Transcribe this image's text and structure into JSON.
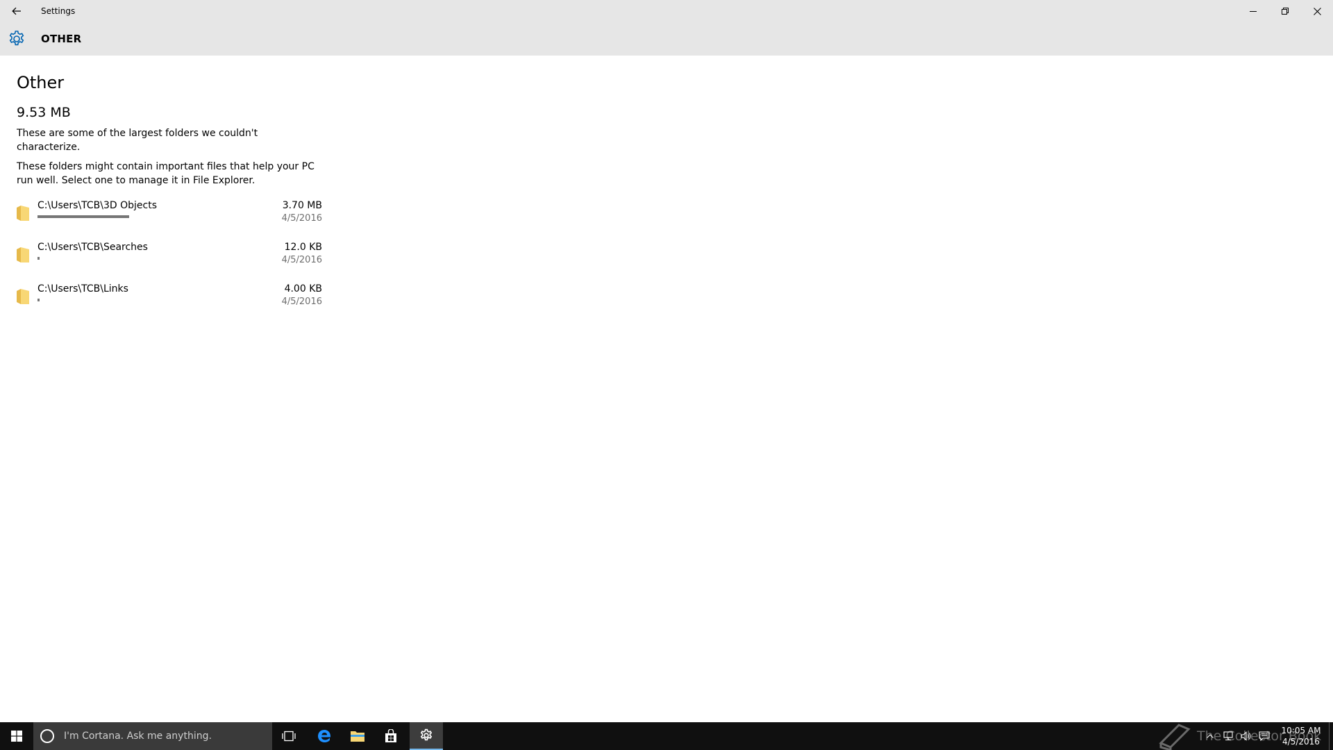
{
  "titlebar": {
    "title": "Settings",
    "back_icon": "back-arrow-icon",
    "minimize_icon": "minimize-icon",
    "restore_icon": "restore-icon",
    "close_icon": "close-icon"
  },
  "header": {
    "icon": "gear-icon",
    "title": "OTHER",
    "accent": "#0063b1"
  },
  "main": {
    "page_title": "Other",
    "total_size": "9.53 MB",
    "description_1": "These are some of the largest folders we couldn't characterize.",
    "description_2": "These folders might contain important files that help your PC run well. Select one to manage it in File Explorer.",
    "folders": [
      {
        "path": "C:\\Users\\TCB\\3D Objects",
        "size": "3.70 MB",
        "date": "4/5/2016",
        "usage_fraction": 0.49
      },
      {
        "path": "C:\\Users\\TCB\\Searches",
        "size": "12.0 KB",
        "date": "4/5/2016",
        "usage_fraction": 0.01
      },
      {
        "path": "C:\\Users\\TCB\\Links",
        "size": "4.00 KB",
        "date": "4/5/2016",
        "usage_fraction": 0.01
      }
    ]
  },
  "taskbar": {
    "search_placeholder": "I'm Cortana. Ask me anything.",
    "apps": [
      "task-view-icon",
      "edge-icon",
      "file-explorer-icon",
      "store-icon",
      "settings-icon"
    ],
    "watermark_text": "The Collector Book",
    "clock_time": "10:05 AM",
    "clock_date": "4/5/2016",
    "taskbar_color": "#101010",
    "active_accent": "#76b9ed"
  }
}
